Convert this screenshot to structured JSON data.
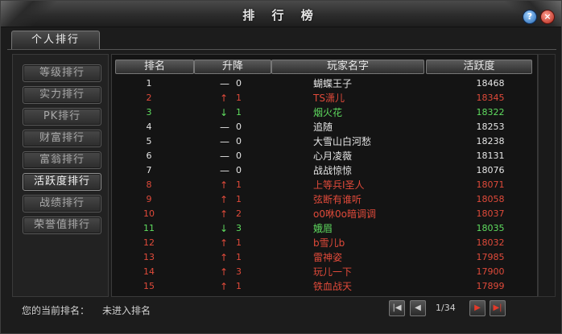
{
  "window": {
    "title": "排 行 榜",
    "help_label": "?",
    "close_label": "×"
  },
  "tabs": [
    {
      "label": "个人排行"
    }
  ],
  "sidebar": {
    "items": [
      {
        "label": "等级排行"
      },
      {
        "label": "实力排行"
      },
      {
        "label": "PK排行"
      },
      {
        "label": "财富排行"
      },
      {
        "label": "富翁排行"
      },
      {
        "label": "活跃度排行",
        "active": true
      },
      {
        "label": "战绩排行"
      },
      {
        "label": "荣誉值排行"
      }
    ]
  },
  "table": {
    "headers": [
      "排名",
      "升降",
      "玩家名字",
      "活跃度"
    ],
    "rows": [
      {
        "rank": "1",
        "dir": "flat",
        "change": "0",
        "name": "蝴蝶王子",
        "value": "18468",
        "color": "#e6e6e6"
      },
      {
        "rank": "2",
        "dir": "up",
        "change": "1",
        "name": "TS潇儿",
        "value": "18345",
        "color": "#e04a3a"
      },
      {
        "rank": "3",
        "dir": "down",
        "change": "1",
        "name": "烟火花",
        "value": "18322",
        "color": "#5fdc5f"
      },
      {
        "rank": "4",
        "dir": "flat",
        "change": "0",
        "name": "追随",
        "value": "18253",
        "color": "#e6e6e6"
      },
      {
        "rank": "5",
        "dir": "flat",
        "change": "0",
        "name": "大雪山白河愁",
        "value": "18238",
        "color": "#e6e6e6"
      },
      {
        "rank": "6",
        "dir": "flat",
        "change": "0",
        "name": "心月凌薇",
        "value": "18131",
        "color": "#e6e6e6"
      },
      {
        "rank": "7",
        "dir": "flat",
        "change": "0",
        "name": "战战惊惊",
        "value": "18076",
        "color": "#e6e6e6"
      },
      {
        "rank": "8",
        "dir": "up",
        "change": "1",
        "name": "上等兵I圣人",
        "value": "18071",
        "color": "#e04a3a"
      },
      {
        "rank": "9",
        "dir": "up",
        "change": "1",
        "name": "弦断有谁听",
        "value": "18058",
        "color": "#e04a3a"
      },
      {
        "rank": "10",
        "dir": "up",
        "change": "2",
        "name": "o0咻0o暗调调",
        "value": "18037",
        "color": "#e04a3a"
      },
      {
        "rank": "11",
        "dir": "down",
        "change": "3",
        "name": "娥眉",
        "value": "18035",
        "color": "#5fdc5f"
      },
      {
        "rank": "12",
        "dir": "up",
        "change": "1",
        "name": "b雪儿b",
        "value": "18032",
        "color": "#e04a3a"
      },
      {
        "rank": "13",
        "dir": "up",
        "change": "1",
        "name": "雷神姿",
        "value": "17985",
        "color": "#e04a3a"
      },
      {
        "rank": "14",
        "dir": "up",
        "change": "3",
        "name": "玩儿一下",
        "value": "17900",
        "color": "#e04a3a"
      },
      {
        "rank": "15",
        "dir": "up",
        "change": "1",
        "name": "铁血战天",
        "value": "17899",
        "color": "#e04a3a"
      }
    ]
  },
  "footer": {
    "current_rank_label": "您的当前排名：",
    "current_rank_value": "未进入排名",
    "page": "1/34"
  },
  "pager": {
    "first": "first-page-icon",
    "prev": "prev-page-icon",
    "next": "next-page-icon",
    "last": "last-page-icon"
  }
}
